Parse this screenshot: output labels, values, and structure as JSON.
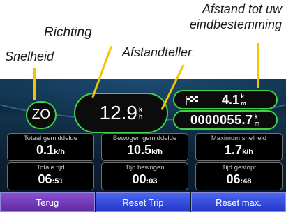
{
  "captions": {
    "distance_to_destination": "Afstand tot uw",
    "distance_to_destination_2": "eindbestemming",
    "direction": "Richting",
    "speed": "Snelheid",
    "odometer": "Afstandteller"
  },
  "colors": {
    "pill_border": "#3fd14a",
    "pointer": "#f2c400",
    "back_button": "#6f3bbd",
    "action_buttons": "#2f48dc"
  },
  "compass": {
    "heading": "ZO"
  },
  "speed": {
    "value": "12.9",
    "unit_top": "k",
    "unit_bottom": "h"
  },
  "destination": {
    "icon": "checkered-flag-icon",
    "value": "4.1",
    "unit_top": "k",
    "unit_bottom": "m"
  },
  "odometer": {
    "value": "0000055.7",
    "unit_top": "k",
    "unit_bottom": "m"
  },
  "tiles": [
    {
      "label": "Totaal gemiddelde",
      "value": "0.1",
      "unit": "k/h"
    },
    {
      "label": "Bewogen gemiddelde",
      "value": "10.5",
      "unit": "k/h"
    },
    {
      "label": "Maximum snelheid",
      "value": "1.7",
      "unit": "k/h"
    },
    {
      "label": "Totale tijd",
      "value": "06",
      "suffix": ":51"
    },
    {
      "label": "Tijd bewogen",
      "value": "00",
      "suffix": ":03"
    },
    {
      "label": "Tijd gestopt",
      "value": "06",
      "suffix": ":48"
    }
  ],
  "buttons": {
    "back": "Terug",
    "reset_trip": "Reset Trip",
    "reset_max": "Reset max."
  }
}
